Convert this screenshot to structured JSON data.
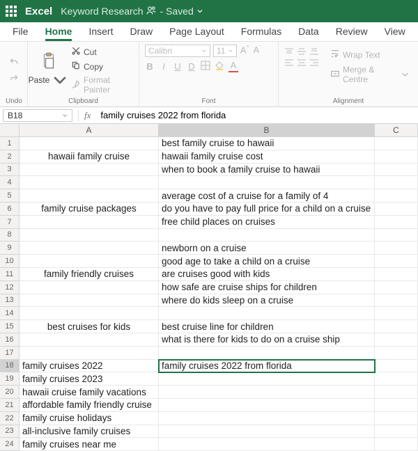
{
  "titlebar": {
    "app_name": "Excel",
    "doc_name": "Keyword Research",
    "save_status": "- Saved"
  },
  "tabs": [
    "File",
    "Home",
    "Insert",
    "Draw",
    "Page Layout",
    "Formulas",
    "Data",
    "Review",
    "View"
  ],
  "active_tab_index": 1,
  "ribbon": {
    "undo_group": "Undo",
    "paste_label": "Paste",
    "cut_label": "Cut",
    "copy_label": "Copy",
    "format_painter_label": "Format Painter",
    "clipboard_group": "Clipboard",
    "font_name": "Calibri",
    "font_size": "11",
    "font_group": "Font",
    "wrap_label": "Wrap Text",
    "merge_label": "Merge & Centre",
    "align_group": "Alignment"
  },
  "namebox": "B18",
  "fx_label": "fx",
  "formula": "family cruises 2022 from florida",
  "columns": [
    "A",
    "B",
    "C"
  ],
  "active_cell": {
    "row": 18,
    "col": "B"
  },
  "rows": [
    {
      "n": 1,
      "a": "",
      "b": "best family cruise to hawaii",
      "a_center": true
    },
    {
      "n": 2,
      "a": "hawaii family cruise",
      "b": "hawaii family cruise cost",
      "a_center": true
    },
    {
      "n": 3,
      "a": "",
      "b": "when to book a family cruise to hawaii",
      "a_center": true
    },
    {
      "n": 4,
      "a": "",
      "b": ""
    },
    {
      "n": 5,
      "a": "",
      "b": "average cost of a cruise for a family of 4",
      "a_center": true
    },
    {
      "n": 6,
      "a": "family cruise packages",
      "b": "do you have to pay full price for a child on a cruise",
      "a_center": true
    },
    {
      "n": 7,
      "a": "",
      "b": "free child places on cruises",
      "a_center": true
    },
    {
      "n": 8,
      "a": "",
      "b": ""
    },
    {
      "n": 9,
      "a": "",
      "b": "newborn on a cruise",
      "a_center": true
    },
    {
      "n": 10,
      "a": "",
      "b": "good age to take a child on a cruise",
      "a_center": true
    },
    {
      "n": 11,
      "a": "family friendly cruises",
      "b": "are cruises good with kids",
      "a_center": true
    },
    {
      "n": 12,
      "a": "",
      "b": "how safe are cruise ships for children",
      "a_center": true
    },
    {
      "n": 13,
      "a": "",
      "b": "where do kids sleep on a cruise",
      "a_center": true
    },
    {
      "n": 14,
      "a": "",
      "b": ""
    },
    {
      "n": 15,
      "a": "best cruises for kids",
      "b": "best cruise line for children",
      "a_center": true
    },
    {
      "n": 16,
      "a": "",
      "b": "what is there for kids to do on a cruise ship",
      "a_center": true
    },
    {
      "n": 17,
      "a": "",
      "b": ""
    },
    {
      "n": 18,
      "a": "family cruises 2022",
      "b": "family cruises 2022 from florida"
    },
    {
      "n": 19,
      "a": "family cruises 2023",
      "b": ""
    },
    {
      "n": 20,
      "a": "hawaii cruise family vacations",
      "b": ""
    },
    {
      "n": 21,
      "a": "affordable family friendly cruise",
      "b": ""
    },
    {
      "n": 22,
      "a": "family cruise holidays",
      "b": ""
    },
    {
      "n": 23,
      "a": "all-inclusive family cruises",
      "b": ""
    },
    {
      "n": 24,
      "a": "family cruises near me",
      "b": ""
    }
  ]
}
